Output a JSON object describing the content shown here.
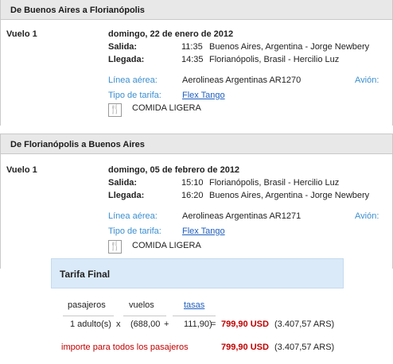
{
  "legs": [
    {
      "title": "De Buenos Aires a Florianópolis",
      "flight_label": "Vuelo 1",
      "date": "domingo, 22 de enero de 2012",
      "departure_label": "Salida:",
      "departure_time": "11:35",
      "departure_place": "Buenos Aires, Argentina - Jorge Newbery",
      "arrival_label": "Llegada:",
      "arrival_time": "14:35",
      "arrival_place": "Florianópolis, Brasil - Hercilio Luz",
      "airline_label": "Línea aérea:",
      "airline_value": "Aerolineas Argentinas AR1270",
      "aircraft_label": "Avión:",
      "fare_type_label": "Tipo de tarifa:",
      "fare_type_value": "Flex Tango",
      "meal_icon": "fork-knife-icon",
      "meal": "COMIDA LIGERA"
    },
    {
      "title": "De Florianópolis a Buenos Aires",
      "flight_label": "Vuelo 1",
      "date": "domingo, 05 de febrero de 2012",
      "departure_label": "Salida:",
      "departure_time": "15:10",
      "departure_place": "Florianópolis, Brasil - Hercilio Luz",
      "arrival_label": "Llegada:",
      "arrival_time": "16:20",
      "arrival_place": "Buenos Aires, Argentina - Jorge Newbery",
      "airline_label": "Línea aérea:",
      "airline_value": "Aerolineas Argentinas AR1271",
      "aircraft_label": "Avión:",
      "fare_type_label": "Tipo de tarifa:",
      "fare_type_value": "Flex Tango",
      "meal_icon": "fork-knife-icon",
      "meal": "COMIDA LIGERA"
    }
  ],
  "fare": {
    "title": "Tarifa Final",
    "col_passengers": "pasajeros",
    "col_flights": "vuelos",
    "col_taxes": "tasas",
    "passengers": "1 adulto(s)",
    "times": "x",
    "open_paren": "(688,00",
    "plus": "+",
    "taxes": "111,90)",
    "equals": "=",
    "subtotal": "799,90 USD",
    "subtotal_ars": "(3.407,57 ARS)",
    "total_label": "importe para todos los pasajeros",
    "total": "799,90 USD",
    "total_ars": "(3.407,57 ARS)"
  },
  "colors": {
    "label_blue": "#3b8fd0",
    "link_blue": "#1f5fbf",
    "total_red": "#c00000",
    "fare_header_bg": "#dbeaf8",
    "leg_header_bg": "#e8e8e8"
  }
}
